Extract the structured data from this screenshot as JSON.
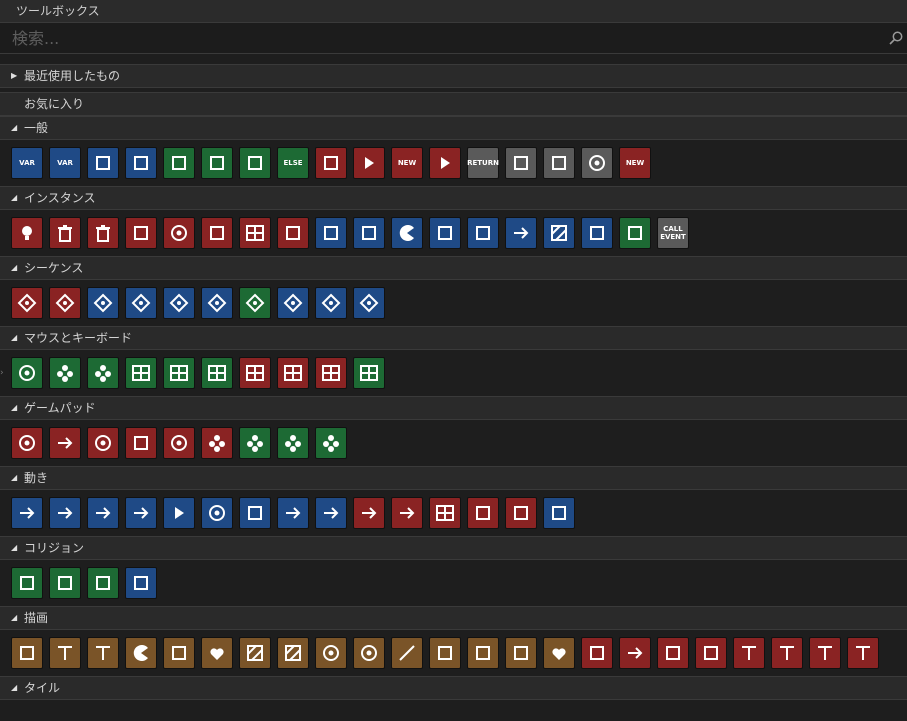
{
  "window": {
    "title": "ツールボックス"
  },
  "search": {
    "placeholder": "検索..."
  },
  "recent": {
    "label": "最近使用したもの"
  },
  "favorites": {
    "label": "お気に入り"
  },
  "sections": [
    {
      "label": "一般",
      "tiles": [
        {
          "c": "blue",
          "icon": "var-declare-icon",
          "t": "VAR"
        },
        {
          "c": "blue",
          "icon": "var-temp-icon",
          "t": "VAR"
        },
        {
          "c": "blue",
          "icon": "var-local-icon"
        },
        {
          "c": "blue",
          "icon": "var-global-icon"
        },
        {
          "c": "green",
          "icon": "if-tree-icon"
        },
        {
          "c": "green",
          "icon": "if-check-icon"
        },
        {
          "c": "green",
          "icon": "if-unknown-icon"
        },
        {
          "c": "green",
          "icon": "else-icon",
          "t": "ELSE"
        },
        {
          "c": "red",
          "icon": "script-icon"
        },
        {
          "c": "red",
          "icon": "play-icon"
        },
        {
          "c": "red",
          "icon": "code-block-icon",
          "t": "NEW"
        },
        {
          "c": "red",
          "icon": "fast-forward-icon"
        },
        {
          "c": "gray",
          "icon": "return-icon",
          "t": "RETURN"
        },
        {
          "c": "gray",
          "icon": "key-icon"
        },
        {
          "c": "gray",
          "icon": "switch-icon"
        },
        {
          "c": "gray",
          "icon": "close-circle-icon"
        },
        {
          "c": "red",
          "icon": "new-chevron-icon",
          "t": "NEW"
        }
      ]
    },
    {
      "label": "インスタンス",
      "tiles": [
        {
          "c": "red",
          "icon": "bulb-icon"
        },
        {
          "c": "red",
          "icon": "destroy-icon"
        },
        {
          "c": "red",
          "icon": "trash-icon"
        },
        {
          "c": "red",
          "icon": "link-icon"
        },
        {
          "c": "red",
          "icon": "alarm-icon"
        },
        {
          "c": "red",
          "icon": "timer-frame-icon"
        },
        {
          "c": "red",
          "icon": "instance-grid-icon"
        },
        {
          "c": "red",
          "icon": "instance-flag-icon"
        },
        {
          "c": "blue",
          "icon": "spread-icon"
        },
        {
          "c": "blue",
          "icon": "gather-icon"
        },
        {
          "c": "blue",
          "icon": "pacman-icon"
        },
        {
          "c": "blue",
          "icon": "rotate-icon"
        },
        {
          "c": "blue",
          "icon": "run-icon"
        },
        {
          "c": "blue",
          "icon": "sprite-move-icon"
        },
        {
          "c": "blue",
          "icon": "square-gradient-icon"
        },
        {
          "c": "blue",
          "icon": "sprite-flip-icon"
        },
        {
          "c": "green",
          "icon": "select-gear-icon"
        },
        {
          "c": "gray",
          "icon": "call-event-icon",
          "t": "CALL EVENT"
        }
      ]
    },
    {
      "label": "シーケンス",
      "tiles": [
        {
          "c": "red",
          "icon": "seq-add-icon"
        },
        {
          "c": "red",
          "icon": "seq-home-icon"
        },
        {
          "c": "blue",
          "icon": "seq-play-icon"
        },
        {
          "c": "blue",
          "icon": "seq-time-icon"
        },
        {
          "c": "blue",
          "icon": "seq-up-icon"
        },
        {
          "c": "blue",
          "icon": "seq-house-icon"
        },
        {
          "c": "green",
          "icon": "seq-brace-icon"
        },
        {
          "c": "blue",
          "icon": "seq-crown-icon"
        },
        {
          "c": "blue",
          "icon": "seq-split-icon"
        },
        {
          "c": "blue",
          "icon": "seq-merge-icon"
        }
      ]
    },
    {
      "label": "マウスとキーボード",
      "tiles": [
        {
          "c": "green",
          "icon": "mouse-circle-icon"
        },
        {
          "c": "green",
          "icon": "mouse-down-icon"
        },
        {
          "c": "green",
          "icon": "mouse-up-icon"
        },
        {
          "c": "green",
          "icon": "grid-four-icon"
        },
        {
          "c": "green",
          "icon": "grid-down-icon"
        },
        {
          "c": "green",
          "icon": "grid-up-icon"
        },
        {
          "c": "red",
          "icon": "keyboard-icon"
        },
        {
          "c": "red",
          "icon": "keyboard-down-icon"
        },
        {
          "c": "red",
          "icon": "keyboard-cursor-icon"
        },
        {
          "c": "green",
          "icon": "keyboard-green-icon"
        }
      ]
    },
    {
      "label": "ゲームパッド",
      "tiles": [
        {
          "c": "red",
          "icon": "crosshair-icon"
        },
        {
          "c": "red",
          "icon": "export-icon"
        },
        {
          "c": "red",
          "icon": "dpad-circle-icon"
        },
        {
          "c": "red",
          "icon": "gamepad-person-icon"
        },
        {
          "c": "red",
          "icon": "target-icon"
        },
        {
          "c": "red",
          "icon": "buttons-red-icon"
        },
        {
          "c": "green",
          "icon": "buttons-green-icon"
        },
        {
          "c": "green",
          "icon": "buttons-green2-icon"
        },
        {
          "c": "green",
          "icon": "buttons-green3-icon"
        }
      ]
    },
    {
      "label": "動き",
      "tiles": [
        {
          "c": "blue",
          "icon": "move-icon"
        },
        {
          "c": "blue",
          "icon": "move-alt-icon"
        },
        {
          "c": "blue",
          "icon": "jump-to-icon"
        },
        {
          "c": "blue",
          "icon": "random-move-icon"
        },
        {
          "c": "blue",
          "icon": "speed-icon"
        },
        {
          "c": "blue",
          "icon": "circle-arrow-icon"
        },
        {
          "c": "blue",
          "icon": "gravity-icon"
        },
        {
          "c": "blue",
          "icon": "wrap-icon"
        },
        {
          "c": "blue",
          "icon": "bounce-icon"
        },
        {
          "c": "red",
          "icon": "turn-icon"
        },
        {
          "c": "red",
          "icon": "turn-right-icon"
        },
        {
          "c": "red",
          "icon": "grid-snap-icon"
        },
        {
          "c": "red",
          "icon": "command-icon"
        },
        {
          "c": "red",
          "icon": "path-icon"
        },
        {
          "c": "blue",
          "icon": "land-icon"
        }
      ]
    },
    {
      "label": "コリジョン",
      "tiles": [
        {
          "c": "green",
          "icon": "collision-box-icon"
        },
        {
          "c": "green",
          "icon": "collision-wall-icon"
        },
        {
          "c": "green",
          "icon": "collision-point-icon"
        },
        {
          "c": "blue",
          "icon": "collision-cross-icon"
        }
      ]
    },
    {
      "label": "描画",
      "tiles": [
        {
          "c": "brown",
          "icon": "draw-self-icon"
        },
        {
          "c": "brown",
          "icon": "text-icon"
        },
        {
          "c": "brown",
          "icon": "text-width-icon"
        },
        {
          "c": "brown",
          "icon": "pie-icon"
        },
        {
          "c": "brown",
          "icon": "sprite-draw-icon"
        },
        {
          "c": "brown",
          "icon": "hearts-icon"
        },
        {
          "c": "brown",
          "icon": "hatch-square-icon"
        },
        {
          "c": "brown",
          "icon": "gradient-square-icon"
        },
        {
          "c": "brown",
          "icon": "hatch-circle-icon"
        },
        {
          "c": "brown",
          "icon": "radial-circle-icon"
        },
        {
          "c": "brown",
          "icon": "line-icon"
        },
        {
          "c": "brown",
          "icon": "healthbar-icon"
        },
        {
          "c": "brown",
          "icon": "trophy-icon"
        },
        {
          "c": "brown",
          "icon": "bar-icon"
        },
        {
          "c": "brown",
          "icon": "heart-bar-icon"
        },
        {
          "c": "red",
          "icon": "draw-frame-icon"
        },
        {
          "c": "red",
          "icon": "draw-arrow-icon"
        },
        {
          "c": "red",
          "icon": "image-icon"
        },
        {
          "c": "red",
          "icon": "mountain-icon"
        },
        {
          "c": "red",
          "icon": "font-icon"
        },
        {
          "c": "red",
          "icon": "text-align-icon"
        },
        {
          "c": "red",
          "icon": "text-doc-icon"
        },
        {
          "c": "red",
          "icon": "text-indent-icon"
        }
      ]
    },
    {
      "label": "タイル",
      "tiles": []
    }
  ]
}
